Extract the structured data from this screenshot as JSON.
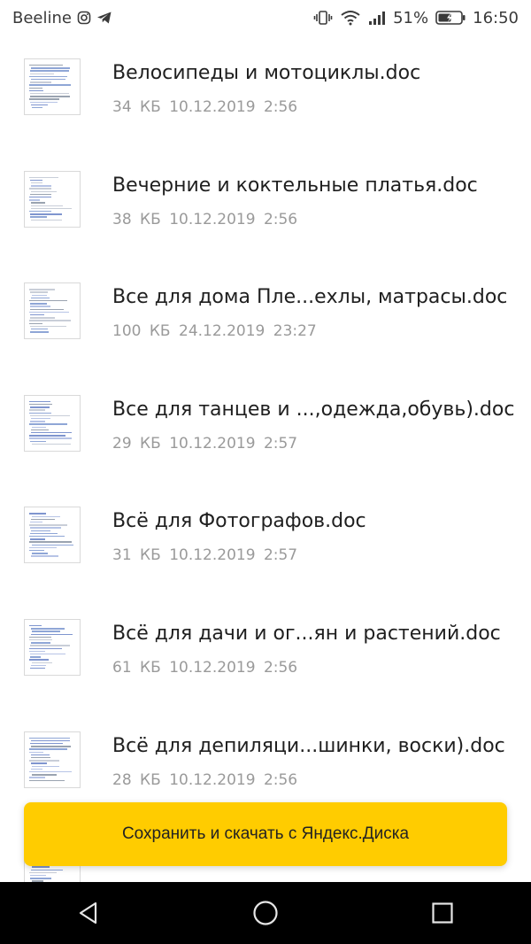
{
  "status_bar": {
    "carrier": "Beeline",
    "battery": "51%",
    "time": "16:50",
    "icons": [
      "instagram-icon",
      "telegram-icon",
      "vibrate-icon",
      "wifi-icon",
      "signal-icon",
      "battery-icon"
    ]
  },
  "files": [
    {
      "name": "Велосипеды и мотоциклы.doc",
      "size": "34 КБ",
      "date": "10.12.2019",
      "time": "2:56"
    },
    {
      "name": "Вечерние и коктельные платья.doc",
      "size": "38 КБ",
      "date": "10.12.2019",
      "time": "2:56"
    },
    {
      "name": "Все для дома Пле...ехлы, матрасы.doc",
      "size": "100 КБ",
      "date": "24.12.2019",
      "time": "23:27"
    },
    {
      "name": "Все для танцев и ...,одежда,обувь).doc",
      "size": "29 КБ",
      "date": "10.12.2019",
      "time": "2:57"
    },
    {
      "name": "Всё для Фотографов.doc",
      "size": "31 КБ",
      "date": "10.12.2019",
      "time": "2:57"
    },
    {
      "name": "Всё для дачи и ог...ян и растений.doc",
      "size": "61 КБ",
      "date": "10.12.2019",
      "time": "2:56"
    },
    {
      "name": "Всё для депиляци...шинки, воски).doc",
      "size": "28 КБ",
      "date": "10.12.2019",
      "time": "2:56"
    }
  ],
  "cta": {
    "label": "Сохранить и скачать с Яндекс.Диска"
  },
  "colors": {
    "accent": "#ffcc00",
    "text_primary": "#1f1f1f",
    "text_secondary": "#9a9a9a",
    "nav_background": "#000000"
  }
}
